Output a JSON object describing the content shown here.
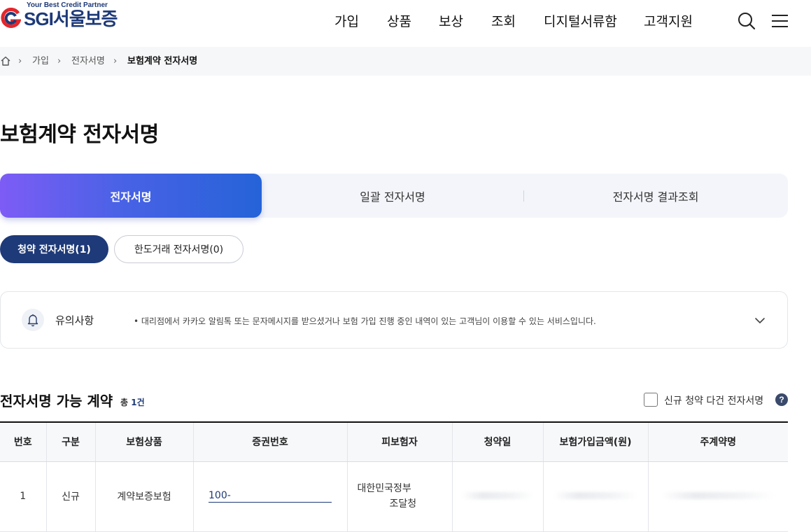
{
  "header": {
    "tagline": "Your Best Credit Partner",
    "brand_latin": "SGI",
    "brand_korean": "서울보증",
    "nav": [
      "가입",
      "상품",
      "보상",
      "조회",
      "디지털서류함",
      "고객지원"
    ]
  },
  "breadcrumb": {
    "items": [
      "가입",
      "전자서명",
      "보험계약 전자서명"
    ]
  },
  "page_title": "보험계약 전자서명",
  "tabs": [
    "전자서명",
    "일괄 전자서명",
    "전자서명 결과조회"
  ],
  "sub_tabs": [
    "청약 전자서명(1)",
    "한도거래 전자서명(0)"
  ],
  "notice": {
    "label": "유의사항",
    "text": "• 대리점에서 카카오 알림톡 또는 문자메시지를 받으셨거나 보험 가입 진행 중인 내역이 있는 고객님이 이용할 수 있는 서비스입니다."
  },
  "list": {
    "title": "전자서명 가능 계약",
    "count_prefix": "총",
    "count_value": "1건",
    "multi_sign_label": "신규 청약 다건 전자서명",
    "help": "?"
  },
  "table": {
    "headers": [
      "번호",
      "구분",
      "보험상품",
      "증권번호",
      "피보험자",
      "청약일",
      "보험가입금액(원)",
      "주계약명"
    ],
    "rows": [
      {
        "no": "1",
        "type": "신규",
        "product": "계약보증보험",
        "policy_no": "100-",
        "insured_line1": "대한민국정부",
        "insured_line2": "조달청"
      }
    ]
  },
  "colors": {
    "brand_navy": "#1e3a78",
    "logo_red": "#e4262b",
    "tab_gradient_start": "#7d5cf5",
    "tab_gradient_end": "#2563d8"
  }
}
